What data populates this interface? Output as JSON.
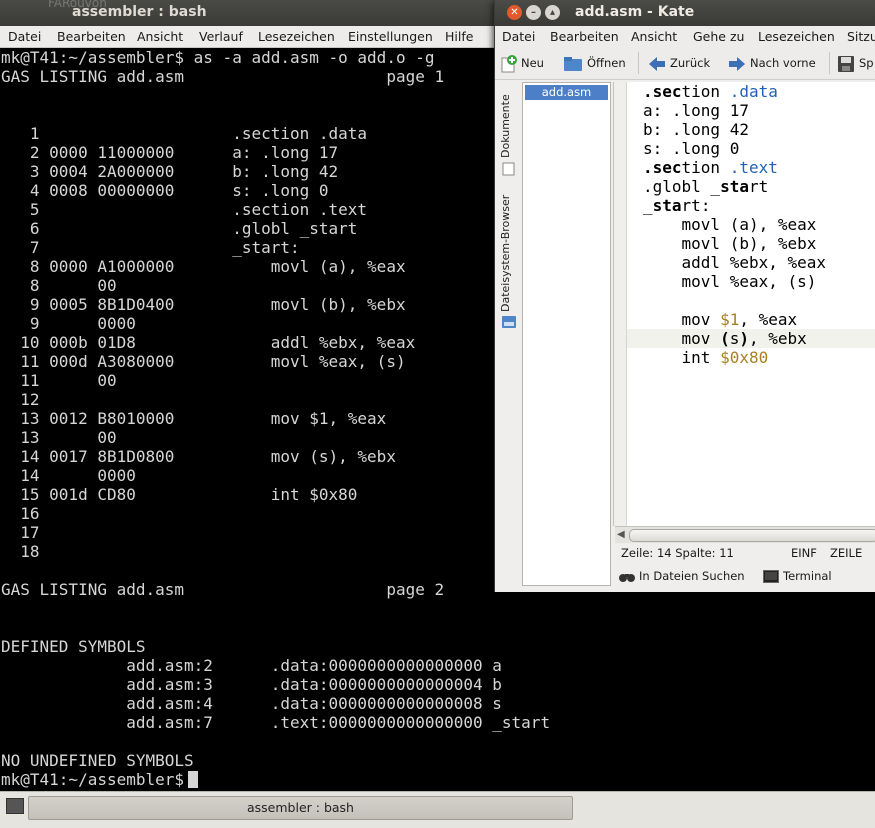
{
  "terminal": {
    "bg_text": "FARouvon",
    "title": "assembler : bash",
    "menu": [
      "Datei",
      "Bearbeiten",
      "Ansicht",
      "Verlauf",
      "Lesezeichen",
      "Einstellungen",
      "Hilfe"
    ],
    "lines": [
      "mk@T41:~/assembler$ as -a add.asm -o add.o -g",
      "GAS LISTING add.asm                     page 1",
      "",
      "",
      "   1                    .section .data",
      "   2 0000 11000000      a: .long 17",
      "   3 0004 2A000000      b: .long 42",
      "   4 0008 00000000      s: .long 0",
      "   5                    .section .text",
      "   6                    .globl _start",
      "   7                    _start:",
      "   8 0000 A1000000          movl (a), %eax",
      "   8      00",
      "   9 0005 8B1D0400          movl (b), %ebx",
      "   9      0000",
      "  10 000b 01D8              addl %ebx, %eax",
      "  11 000d A3080000          movl %eax, (s)",
      "  11      00",
      "  12",
      "  13 0012 B8010000          mov $1, %eax",
      "  13      00",
      "  14 0017 8B1D0800          mov (s), %ebx",
      "  14      0000",
      "  15 001d CD80              int $0x80",
      "  16",
      "  17",
      "  18",
      "",
      "GAS LISTING add.asm                     page 2",
      "",
      "",
      "DEFINED SYMBOLS",
      "             add.asm:2      .data:0000000000000000 a",
      "             add.asm:3      .data:0000000000000004 b",
      "             add.asm:4      .data:0000000000000008 s",
      "             add.asm:7      .text:0000000000000000 _start",
      "",
      "NO UNDEFINED SYMBOLS"
    ],
    "prompt": "mk@T41:~/assembler$"
  },
  "taskbar": {
    "task_label": "assembler : bash"
  },
  "kate": {
    "title": "add.asm - Kate",
    "menu": [
      "Datei",
      "Bearbeiten",
      "Ansicht",
      "Gehe zu",
      "Lesezeichen",
      "Sitzu"
    ],
    "toolbar": {
      "new": "Neu",
      "open": "Öffnen",
      "back": "Zurück",
      "forward": "Nach vorne",
      "save": "Sp"
    },
    "side_tabs": {
      "documents": "Dokumente",
      "filesystem": "Dateisystem-Browser"
    },
    "document": "add.asm",
    "status": {
      "position": "Zeile: 14 Spalte: 11",
      "mode": "EINF",
      "sel": "ZEILE"
    },
    "bottom": {
      "find": "In Dateien Suchen",
      "terminal": "Terminal"
    },
    "code": [
      ".section .data",
      "a: .long 17",
      "b: .long 42",
      "s: .long 0",
      ".section .text",
      ".globl _start",
      "_start:",
      "    movl (a), %eax",
      "    movl (b), %ebx",
      "    addl %ebx, %eax",
      "    movl %eax, (s)",
      "",
      "    mov $1, %eax",
      "    mov (s), %ebx",
      "    int $0x80"
    ]
  },
  "colors": {
    "accent_selection": "#4d7fc8",
    "keyword_blue": "#1f62b5",
    "literal_gold": "#a7811f",
    "close_button": "#e25a2b"
  }
}
